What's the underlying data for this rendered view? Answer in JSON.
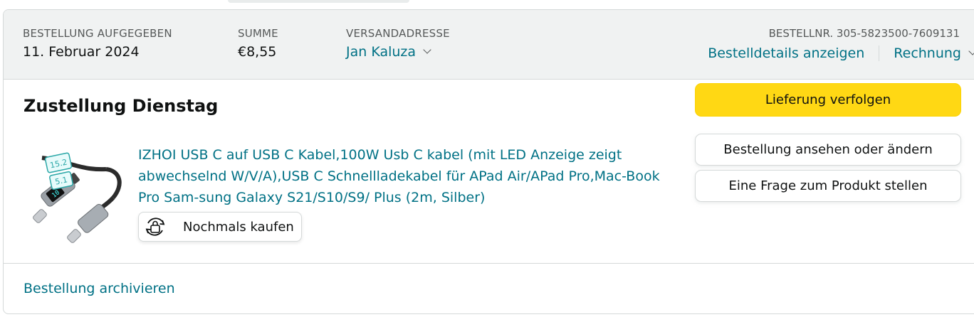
{
  "header": {
    "order_placed_label": "BESTELLUNG AUFGEGEBEN",
    "order_placed_value": "11. Februar 2024",
    "total_label": "SUMME",
    "total_value": "€8,55",
    "ship_to_label": "VERSANDADRESSE",
    "ship_to_value": "Jan Kaluza",
    "order_number": "BESTELLNR. 305-5823500-7609131",
    "order_details_link": "Bestelldetails anzeigen",
    "invoice_link": "Rechnung"
  },
  "shipment": {
    "status": "Zustellung Dienstag",
    "product_title": "IZHOI USB C auf USB C Kabel,100W Usb C kabel (mit LED Anzeige zeigt abwechselnd W/V/A),USB C Schnellladekabel für APad Air/APad Pro,Mac-Book Pro Sam-sung Galaxy S21/S10/S9/ Plus (2m, Silber)",
    "buy_again_label": "Nochmals kaufen",
    "image_display_values": [
      "15.2",
      "5.1",
      "10"
    ]
  },
  "actions": {
    "track_label": "Lieferung verfolgen",
    "view_edit_label": "Bestellung ansehen oder ändern",
    "ask_question_label": "Eine Frage zum Produkt stellen"
  },
  "footer": {
    "archive_label": "Bestellung archivieren"
  },
  "icons": {
    "ship_to_chevron": "chevron-down-icon",
    "invoice_chevron": "chevron-down-icon",
    "buy_again": "buy-again-cycle-icon"
  },
  "colors": {
    "link": "#007185",
    "primary_button": "#ffd814",
    "header_bg": "#f0f2f2",
    "border": "#d5d9d9"
  }
}
